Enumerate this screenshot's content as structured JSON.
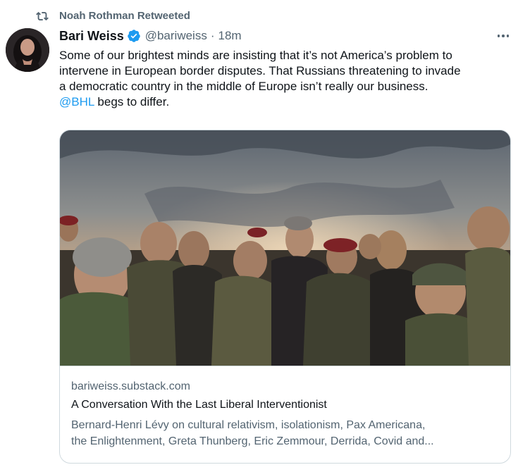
{
  "retweet": {
    "label": "Noah Rothman Retweeted",
    "icon": "retweet-icon"
  },
  "author": {
    "name": "Bari Weiss",
    "verified": true,
    "handle": "@bariweiss",
    "separator": "·",
    "timestamp": "18m",
    "avatar_icon": "avatar"
  },
  "tweet": {
    "lines": [
      "Some of our brightest minds are insisting that it’s not America’s problem to",
      "intervene in European border disputes. That Russians threatening to invade",
      "a democratic country in the middle of Europe isn’t really our business."
    ],
    "mention": "@BHL",
    "after_mention": " begs to differ."
  },
  "card": {
    "domain": "bariweiss.substack.com",
    "title": "A Conversation With the Last Liberal Interventionist",
    "description_lines": [
      "Bernard-Henri Lévy on cultural relativism, isolationism, Pax Americana,",
      "the Enlightenment, Greta Thunberg, Eric Zemmour, Derrida, Covid and..."
    ]
  },
  "colors": {
    "accent": "#1d9bf0",
    "text_primary": "#0f1419",
    "text_secondary": "#536471",
    "border": "#cfd9de"
  }
}
